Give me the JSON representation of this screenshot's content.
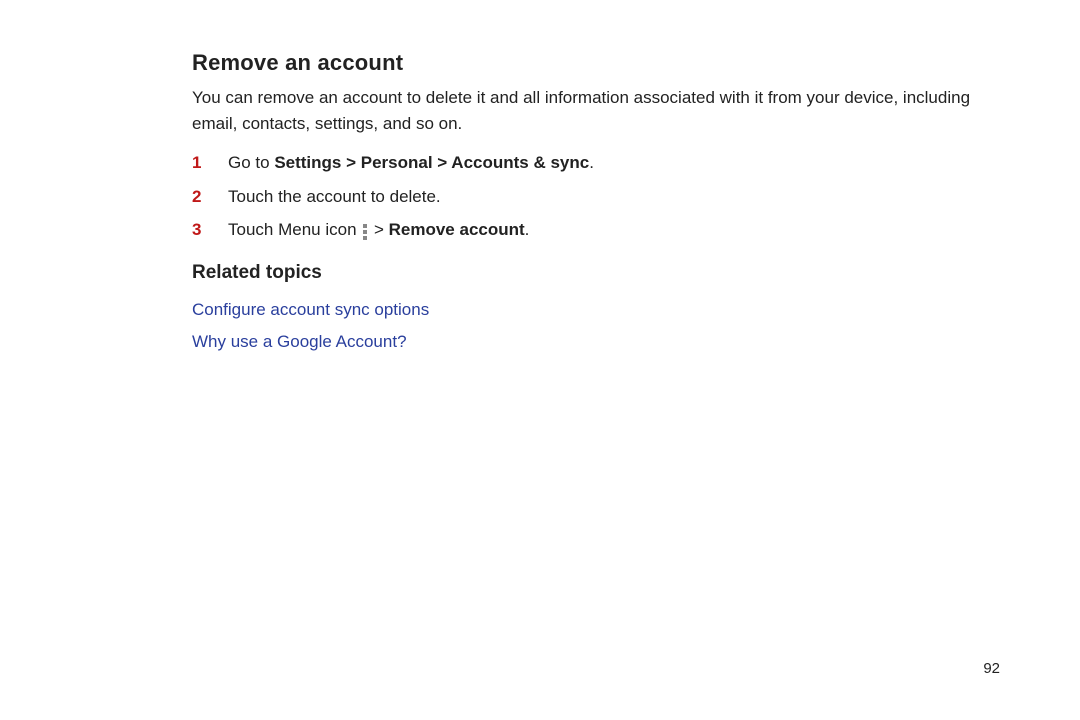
{
  "section": {
    "heading": "Remove an account",
    "intro": "You can remove an account to delete it and all information associated with it from your device, including email, contacts, settings, and so on.",
    "steps": [
      {
        "num": "1",
        "pre": "Go to ",
        "bold": "Settings > Personal > Accounts & sync",
        "post": "."
      },
      {
        "num": "2",
        "pre": "Touch the account to delete.",
        "bold": "",
        "post": ""
      },
      {
        "num": "3",
        "pre": "Touch Menu icon ",
        "icon": "menu-overflow",
        "mid": " > ",
        "bold": "Remove account",
        "post": "."
      }
    ]
  },
  "related": {
    "heading": "Related topics",
    "links": [
      "Configure account sync options",
      "Why use a Google Account?"
    ]
  },
  "page_number": "92"
}
